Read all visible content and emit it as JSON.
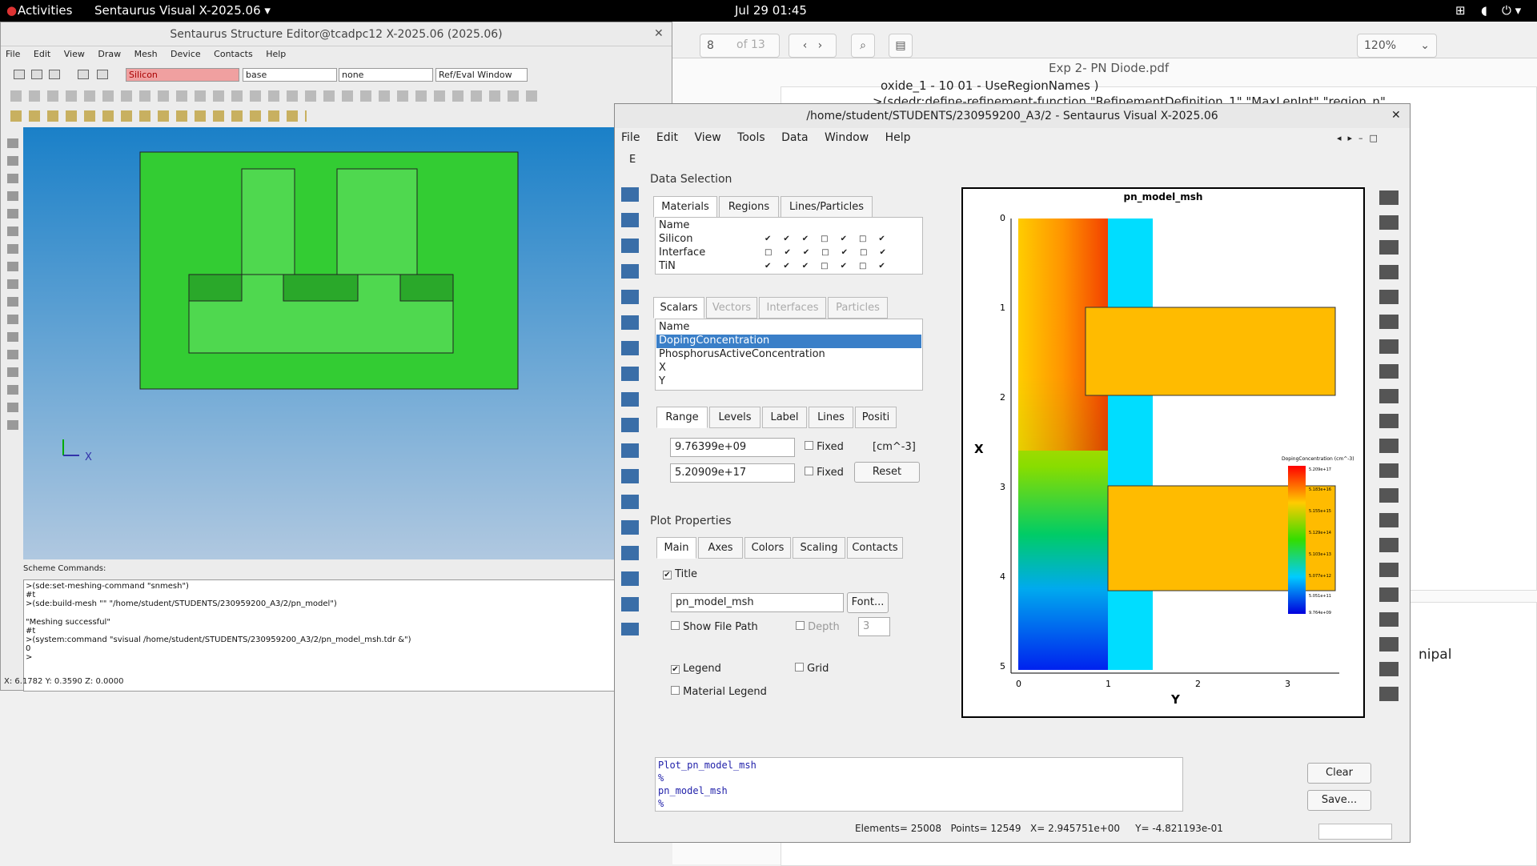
{
  "topbar": {
    "activities": "Activities",
    "app": "Sentaurus Visual X-2025.06 ▾",
    "clock": "Jul 29  01:45"
  },
  "pdf": {
    "page": "8",
    "of": "of 13",
    "title": "Exp 2- PN Diode.pdf",
    "zoom": "120%",
    "snippet1": "oxide_1 - 10 01 - UseRegionNames )",
    "snippet2": ">(sdedr:define-refinement-function \"RefinementDefinition_1\" \"MaxLenInt\" \"region_n\"",
    "snippet3": "nipal"
  },
  "sse": {
    "title": "Sentaurus Structure Editor@tcadpc12 X-2025.06 (2025.06)",
    "menu": [
      "File",
      "Edit",
      "View",
      "Draw",
      "Mesh",
      "Device",
      "Contacts",
      "Help"
    ],
    "material": "Silicon",
    "region": "base",
    "refinement": "none",
    "window": "Ref/Eval Window",
    "cmd_label": "Scheme Commands:",
    "cmd_lines": [
      ">(sde:set-meshing-command \"snmesh\")",
      "#t",
      ">(sde:build-mesh \"\" \"/home/student/STUDENTS/230959200_A3/2/pn_model\")",
      "",
      "\"Meshing successful\"",
      "#t",
      ">(system:command \"svisual /home/student/STUDENTS/230959200_A3/2/pn_model_msh.tdr &\")",
      "0",
      ">"
    ],
    "coords": "X: 6.1782 Y: 0.3590 Z: 0.0000",
    "axis_x": "X"
  },
  "sv": {
    "title": "/home/student/STUDENTS/230959200_A3/2 - Sentaurus Visual X-2025.06",
    "menu": [
      "File",
      "Edit",
      "View",
      "Tools",
      "Data",
      "Window",
      "Help"
    ],
    "tab_e": "E",
    "data_selection": "Data Selection",
    "ds_tabs": [
      "Materials",
      "Regions",
      "Lines/Particles"
    ],
    "mat_name_hdr": "Name",
    "materials": [
      "Silicon",
      "Interface",
      "TiN"
    ],
    "sc_tabs": [
      "Scalars",
      "Vectors",
      "Interfaces",
      "Particles"
    ],
    "sc_name_hdr": "Name",
    "scalars": [
      "DopingConcentration",
      "PhosphorusActiveConcentration",
      "X",
      "Y"
    ],
    "range_tabs": [
      "Range",
      "Levels",
      "Label",
      "Lines",
      "Positi"
    ],
    "min": "9.76399e+09",
    "max": "5.20909e+17",
    "fixed": "Fixed",
    "unit": "[cm^-3]",
    "reset": "Reset",
    "plot_props": "Plot Properties",
    "pp_tabs": [
      "Main",
      "Axes",
      "Colors",
      "Scaling",
      "Contacts"
    ],
    "title_cb": "Title",
    "title_val": "pn_model_msh",
    "font_btn": "Font...",
    "show_path": "Show File Path",
    "depth": "Depth",
    "depth_val": "3",
    "legend": "Legend",
    "grid": "Grid",
    "mat_legend": "Material Legend",
    "console": [
      "Plot_pn_model_msh",
      "%",
      "pn_model_msh",
      "%"
    ],
    "clear": "Clear",
    "save": "Save...",
    "status": {
      "elements": "Elements= 25008",
      "points": "Points= 12549",
      "x": "X= 2.945751e+00",
      "y": "Y= -4.821193e-01"
    },
    "plot": {
      "title": "pn_model_msh",
      "xlabel": "Y",
      "ylabel": "X",
      "xticks": [
        "0",
        "1",
        "2",
        "3"
      ],
      "yticks": [
        "0",
        "1",
        "2",
        "3",
        "4",
        "5"
      ],
      "legend_title": "DopingConcentration (cm^-3)",
      "legend_vals": [
        "5.209e+17",
        "5.183e+16",
        "5.155e+15",
        "5.129e+14",
        "5.103e+13",
        "5.077e+12",
        "5.051e+11",
        "9.764e+09"
      ]
    }
  }
}
